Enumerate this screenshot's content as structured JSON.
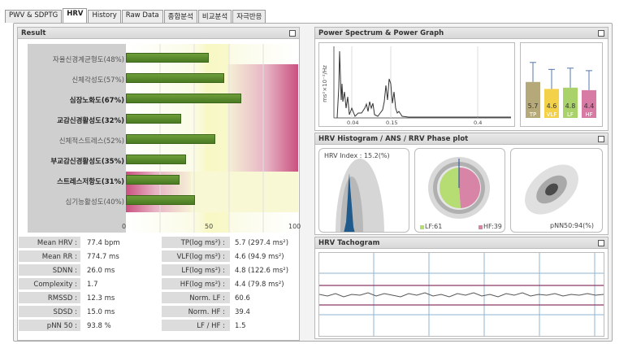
{
  "tabs": [
    "PWV & SDPTG",
    "HRV",
    "History",
    "Raw Data",
    "종합분석",
    "비교분석",
    "자극반응"
  ],
  "result": {
    "title": "Result",
    "rows": [
      {
        "label": "자율신경계균형도(48%)",
        "value": 48,
        "bold": false
      },
      {
        "label": "신체각성도(57%)",
        "value": 57,
        "bold": false
      },
      {
        "label": "심장노화도(67%)",
        "value": 67,
        "bold": true
      },
      {
        "label": "교감신경활성도(32%)",
        "value": 32,
        "bold": true
      },
      {
        "label": "신체적스트레스(52%)",
        "value": 52,
        "bold": false
      },
      {
        "label": "부교감신경활성도(35%)",
        "value": 35,
        "bold": true
      },
      {
        "label": "스트레스저항도(31%)",
        "value": 31,
        "bold": true
      },
      {
        "label": "심기능활성도(40%)",
        "value": 40,
        "bold": false
      }
    ],
    "axis": [
      "0",
      "50",
      "100"
    ]
  },
  "stats_left": [
    {
      "label": "Mean HRV :",
      "value": "77.4 bpm"
    },
    {
      "label": "Mean RR :",
      "value": "774.7 ms"
    },
    {
      "label": "SDNN :",
      "value": "26.0 ms"
    },
    {
      "label": "Complexity :",
      "value": "1.7"
    },
    {
      "label": "RMSSD :",
      "value": "12.3 ms"
    },
    {
      "label": "SDSD :",
      "value": "15.0 ms"
    },
    {
      "label": "pNN 50 :",
      "value": "93.8 %"
    }
  ],
  "stats_right": [
    {
      "label": "TP(log ms²) :",
      "value": "5.7 (297.4 ms²)"
    },
    {
      "label": "VLF(log ms²) :",
      "value": "4.6 (94.9 ms²)"
    },
    {
      "label": "LF(log ms²) :",
      "value": "4.8 (122.6 ms²)"
    },
    {
      "label": "HF(log ms²) :",
      "value": "4.4 (79.8 ms²)"
    },
    {
      "label": "Norm. LF :",
      "value": "60.6"
    },
    {
      "label": "Norm. HF :",
      "value": "39.4"
    },
    {
      "label": "LF / HF :",
      "value": "1.5"
    }
  ],
  "power": {
    "title": "Power Spectrum & Power Graph",
    "ylabel": "ms²×10⁻²/Hz",
    "xticks": [
      "0.04",
      "0.15",
      "0.4"
    ],
    "bars": [
      {
        "value": "5.7",
        "name": "TP",
        "color": "#b5a97a"
      },
      {
        "value": "4.6",
        "name": "VLF",
        "color": "#f3d24a"
      },
      {
        "value": "4.8",
        "name": "LF",
        "color": "#a9d36a"
      },
      {
        "value": "4.4",
        "name": "HF",
        "color": "#d77ba4"
      }
    ]
  },
  "histogram": {
    "title": "HRV Histogram / ANS / RRV Phase plot",
    "hrv_index": "HRV Index : 15.2(%)",
    "lf": "LF:61",
    "hf": "HF:39",
    "pnn": "pNN50:94(%)"
  },
  "tachogram": {
    "title": "HRV Tachogram"
  }
}
